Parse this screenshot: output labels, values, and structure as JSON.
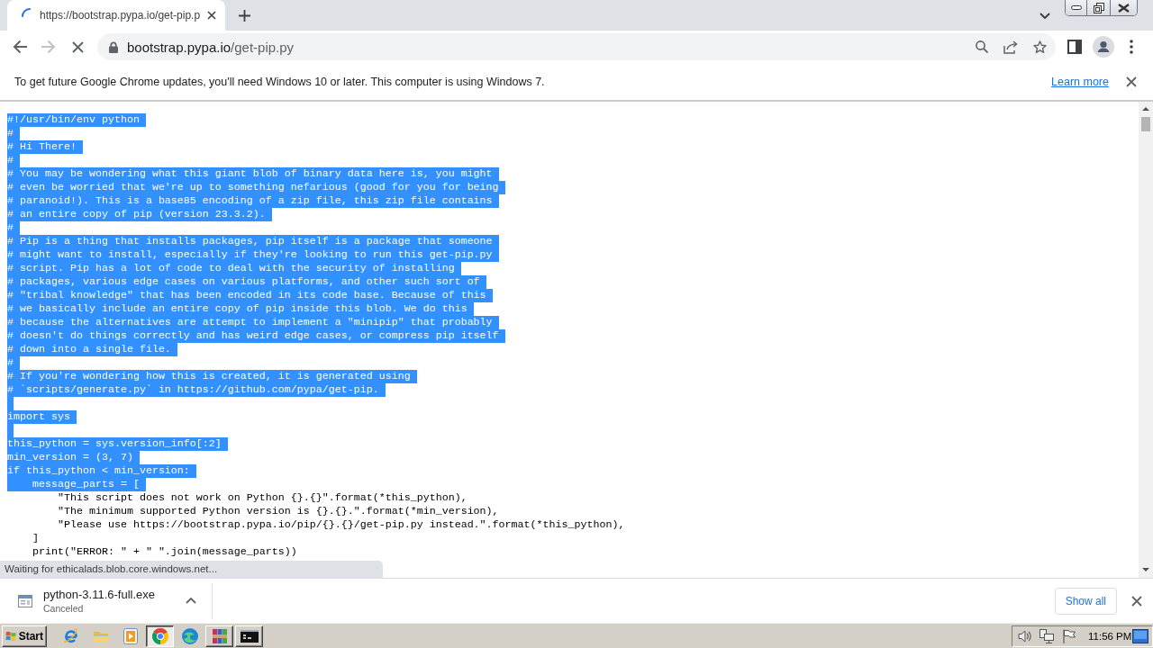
{
  "tabs": [
    {
      "title": "https://bootstrap.pypa.io/get-pip.p",
      "selected": true,
      "loading": true
    }
  ],
  "toolbar": {
    "buttons": [
      {
        "kind": "back",
        "disabled": false
      },
      {
        "kind": "forward",
        "disabled": true
      },
      {
        "kind": "stop",
        "disabled": false
      }
    ],
    "address": {
      "host": "bootstrap.pypa.io",
      "path": "/get-pip.py"
    }
  },
  "infobar": {
    "message": "To get future Google Chrome updates, you'll need Windows 10 or later. This computer is using Windows 7.",
    "link": "Learn more"
  },
  "code_lines": [
    {
      "text": "#!/usr/bin/env python",
      "selected": true
    },
    {
      "text": "#",
      "selected": true
    },
    {
      "text": "# Hi There!",
      "selected": true
    },
    {
      "text": "#",
      "selected": true
    },
    {
      "text": "# You may be wondering what this giant blob of binary data here is, you might",
      "selected": true
    },
    {
      "text": "# even be worried that we're up to something nefarious (good for you for being",
      "selected": true
    },
    {
      "text": "# paranoid!). This is a base85 encoding of a zip file, this zip file contains",
      "selected": true
    },
    {
      "text": "# an entire copy of pip (version 23.3.2).",
      "selected": true
    },
    {
      "text": "#",
      "selected": true
    },
    {
      "text": "# Pip is a thing that installs packages, pip itself is a package that someone",
      "selected": true
    },
    {
      "text": "# might want to install, especially if they're looking to run this get-pip.py",
      "selected": true
    },
    {
      "text": "# script. Pip has a lot of code to deal with the security of installing",
      "selected": true
    },
    {
      "text": "# packages, various edge cases on various platforms, and other such sort of",
      "selected": true
    },
    {
      "text": "# \"tribal knowledge\" that has been encoded in its code base. Because of this",
      "selected": true
    },
    {
      "text": "# we basically include an entire copy of pip inside this blob. We do this",
      "selected": true
    },
    {
      "text": "# because the alternatives are attempt to implement a \"minipip\" that probably",
      "selected": true
    },
    {
      "text": "# doesn't do things correctly and has weird edge cases, or compress pip itself",
      "selected": true
    },
    {
      "text": "# down into a single file.",
      "selected": true
    },
    {
      "text": "#",
      "selected": true
    },
    {
      "text": "# If you're wondering how this is created, it is generated using",
      "selected": true
    },
    {
      "text": "# `scripts/generate.py` in https://github.com/pypa/get-pip.",
      "selected": true
    },
    {
      "selected": true
    },
    {
      "text": "import sys",
      "selected": true
    },
    {
      "selected": true
    },
    {
      "text": "this_python = sys.version_info[:2]",
      "selected": true
    },
    {
      "text": "min_version = (3, 7)",
      "selected": true
    },
    {
      "text": "if this_python < min_version:",
      "selected": true
    },
    {
      "text": "    message_parts = [",
      "selected": true
    },
    {
      "text": "        \"This script does not work on Python {}.{}\".format(*this_python),",
      "selected": false
    },
    {
      "text": "        \"The minimum supported Python version is {}.{}.\".format(*min_version),",
      "selected": false
    },
    {
      "text": "        \"Please use https://bootstrap.pypa.io/pip/{}.{}/get-pip.py instead.\".format(*this_python),",
      "selected": false
    },
    {
      "text": "    ]",
      "selected": false
    },
    {
      "text": "    print(\"ERROR: \" + \" \".join(message_parts))",
      "selected": false
    }
  ],
  "status_bubble": "Waiting for ethicalads.blob.core.windows.net...",
  "downloads": {
    "items": [
      {
        "filename": "python-3.11.6-full.exe",
        "status": "Canceled"
      }
    ],
    "show_all": "Show all"
  },
  "taskbar": {
    "start": "Start",
    "apps": [
      {
        "kind": "ie",
        "running": false,
        "selected": false
      },
      {
        "kind": "folder",
        "running": false,
        "selected": false
      },
      {
        "kind": "media",
        "running": false,
        "selected": false
      },
      {
        "kind": "chrome",
        "running": true,
        "selected": true
      },
      {
        "kind": "edge",
        "running": false,
        "selected": false
      },
      {
        "kind": "archiver",
        "running": true,
        "selected": false
      },
      {
        "kind": "console",
        "running": true,
        "selected": false
      }
    ],
    "clock": "11:56 PM"
  }
}
